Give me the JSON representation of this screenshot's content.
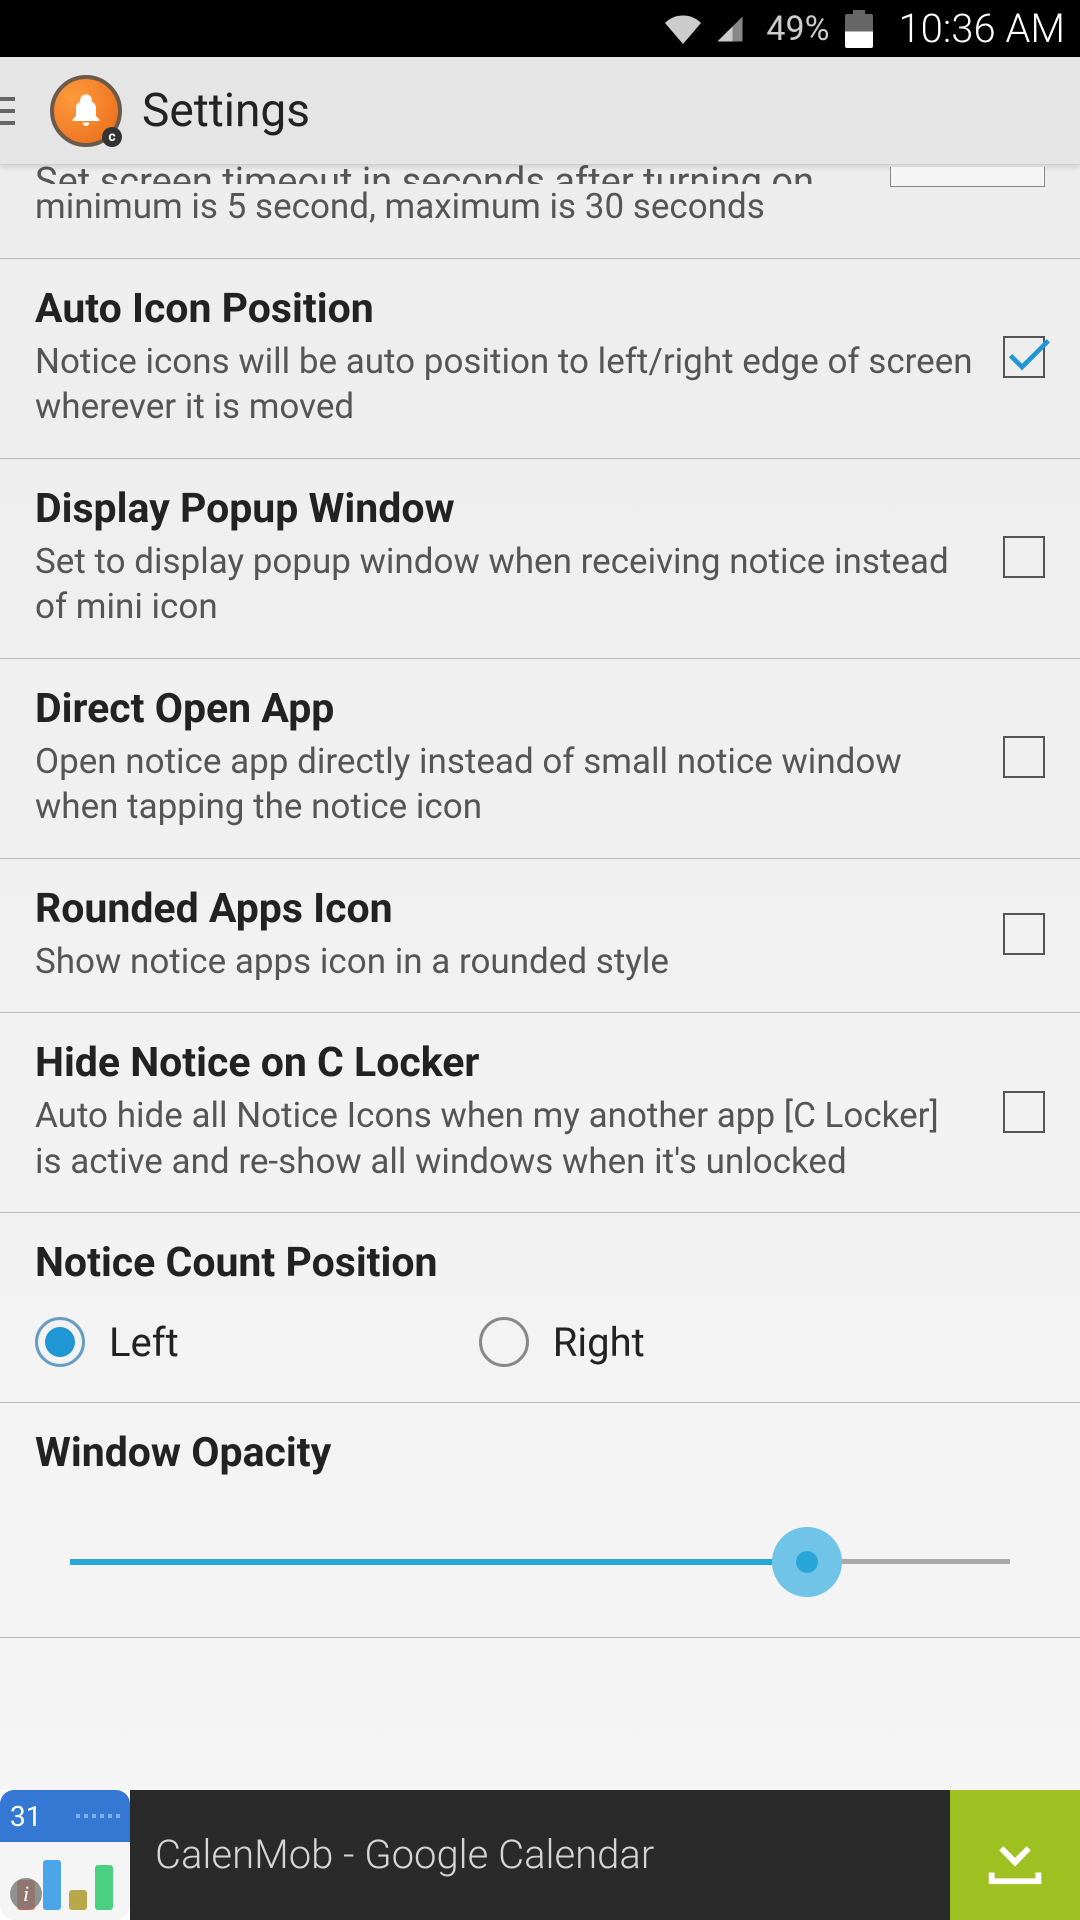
{
  "status_bar": {
    "battery_pct": "49%",
    "time": "10:36 AM"
  },
  "app_bar": {
    "title": "Settings"
  },
  "partial_item": {
    "title_cut": "Set screen timeout in seconds after turning on.",
    "desc": "minimum is 5 second, maximum is 30 seconds"
  },
  "settings": [
    {
      "title": "Auto Icon Position",
      "desc": "Notice icons will be auto position to left/right edge of screen wherever it is moved",
      "checked": true
    },
    {
      "title": "Display Popup Window",
      "desc": "Set to display popup window when receiving notice instead of mini icon",
      "checked": false
    },
    {
      "title": "Direct Open App",
      "desc": "Open notice app directly instead of small notice window when tapping the notice icon",
      "checked": false
    },
    {
      "title": "Rounded Apps Icon",
      "desc": "Show notice apps icon in a rounded style",
      "checked": false
    },
    {
      "title": "Hide Notice on C Locker",
      "desc": "Auto hide all Notice Icons when my another app [C Locker] is active and re-show all windows when it's unlocked",
      "checked": false
    }
  ],
  "notice_position": {
    "title": "Notice Count Position",
    "options": [
      "Left",
      "Right"
    ],
    "selected": "Left"
  },
  "opacity": {
    "title": "Window Opacity",
    "value_pct": 75
  },
  "ad": {
    "icon_date": "31",
    "text": "CalenMob - Google Calendar"
  }
}
